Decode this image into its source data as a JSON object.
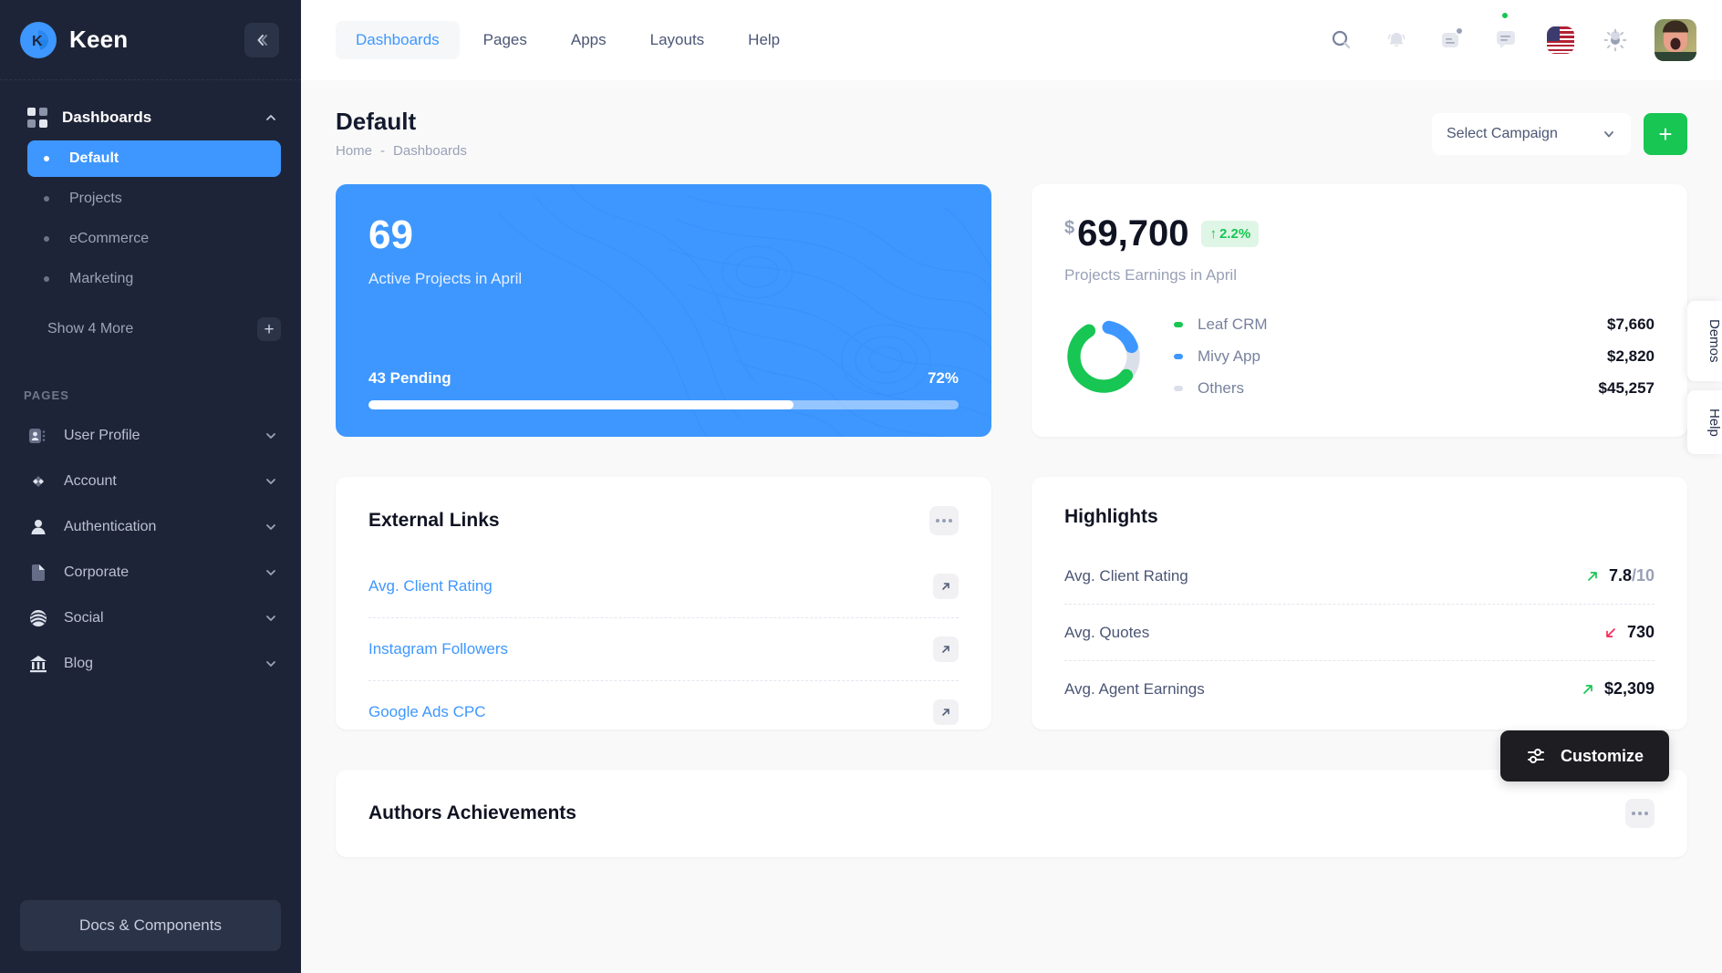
{
  "brand": {
    "name": "Keen",
    "logo_icon": "keen-logo-icon"
  },
  "sidebar": {
    "collapse_icon": "chevron-double-left-icon",
    "dashboards": {
      "label": "Dashboards",
      "icon": "dashboard-grid-icon",
      "chevron": "chevron-up-icon",
      "items": [
        {
          "label": "Default",
          "active": true
        },
        {
          "label": "Projects",
          "active": false
        },
        {
          "label": "eCommerce",
          "active": false
        },
        {
          "label": "Marketing",
          "active": false
        }
      ],
      "show_more_label": "Show 4 More",
      "show_more_icon": "plus-icon"
    },
    "section_label": "PAGES",
    "pages": [
      {
        "label": "User Profile",
        "icon": "profile-card-icon"
      },
      {
        "label": "Account",
        "icon": "diamonds-icon"
      },
      {
        "label": "Authentication",
        "icon": "user-icon"
      },
      {
        "label": "Corporate",
        "icon": "document-icon"
      },
      {
        "label": "Social",
        "icon": "globe-lines-icon"
      },
      {
        "label": "Blog",
        "icon": "bank-icon"
      }
    ],
    "docs_button": "Docs & Components"
  },
  "topbar": {
    "nav": [
      {
        "label": "Dashboards",
        "active": true
      },
      {
        "label": "Pages",
        "active": false
      },
      {
        "label": "Apps",
        "active": false
      },
      {
        "label": "Layouts",
        "active": false
      },
      {
        "label": "Help",
        "active": false
      }
    ],
    "icons": [
      {
        "name": "search-icon"
      },
      {
        "name": "bell-icon"
      },
      {
        "name": "contacts-icon"
      },
      {
        "name": "chat-icon"
      },
      {
        "name": "flag-us-icon"
      },
      {
        "name": "theme-toggle-icon"
      },
      {
        "name": "avatar"
      }
    ]
  },
  "page": {
    "title": "Default",
    "breadcrumb": {
      "home": "Home",
      "sep": "-",
      "current": "Dashboards"
    },
    "campaign_select": {
      "value": "Select Campaign",
      "chevron": "chevron-down-icon"
    },
    "add_button": "+"
  },
  "projects_card": {
    "count": "69",
    "subtitle": "Active Projects in April",
    "pending": "43 Pending",
    "percent_label": "72%",
    "percent": 72,
    "bg_color": "#3e97ff"
  },
  "earnings_card": {
    "currency": "$",
    "amount": "69,700",
    "delta": "2.2%",
    "delta_arrow": "↑",
    "subtitle": "Projects Earnings in April",
    "legend": [
      {
        "name": "Leaf CRM",
        "value": "$7,660",
        "color": "#17c653"
      },
      {
        "name": "Mivy App",
        "value": "$2,820",
        "color": "#3e97ff"
      },
      {
        "name": "Others",
        "value": "$45,257",
        "color": "#dbdfe9"
      }
    ]
  },
  "chart_data": {
    "type": "pie",
    "title": "Projects Earnings in April",
    "categories": [
      "Leaf CRM",
      "Mivy App",
      "Others"
    ],
    "values": [
      7660,
      2820,
      45257
    ],
    "colors": [
      "#17c653",
      "#3e97ff",
      "#dbdfe9"
    ],
    "arc_degrees": [
      200,
      60,
      100
    ],
    "legend_position": "right",
    "grid": false
  },
  "external_links": {
    "title": "External Links",
    "menu_icon": "ellipsis-icon",
    "items": [
      {
        "label": "Avg. Client Rating",
        "icon": "external-link-icon"
      },
      {
        "label": "Instagram Followers",
        "icon": "external-link-icon"
      },
      {
        "label": "Google Ads CPC",
        "icon": "external-link-icon"
      }
    ]
  },
  "highlights": {
    "title": "Highlights",
    "items": [
      {
        "label": "Avg. Client Rating",
        "value": "7.8",
        "suffix": "/10",
        "trend": "up",
        "trend_color": "#17c653"
      },
      {
        "label": "Avg. Quotes",
        "value": "730",
        "suffix": "",
        "trend": "down",
        "trend_color": "#f8285a"
      },
      {
        "label": "Avg. Agent Earnings",
        "value": "$2,309",
        "suffix": "",
        "trend": "up",
        "trend_color": "#17c653"
      }
    ]
  },
  "authors": {
    "title": "Authors Achievements",
    "menu_icon": "ellipsis-icon"
  },
  "side_tabs": [
    {
      "label": "Demos"
    },
    {
      "label": "Help"
    }
  ],
  "customize": {
    "label": "Customize",
    "icon": "sliders-icon"
  }
}
